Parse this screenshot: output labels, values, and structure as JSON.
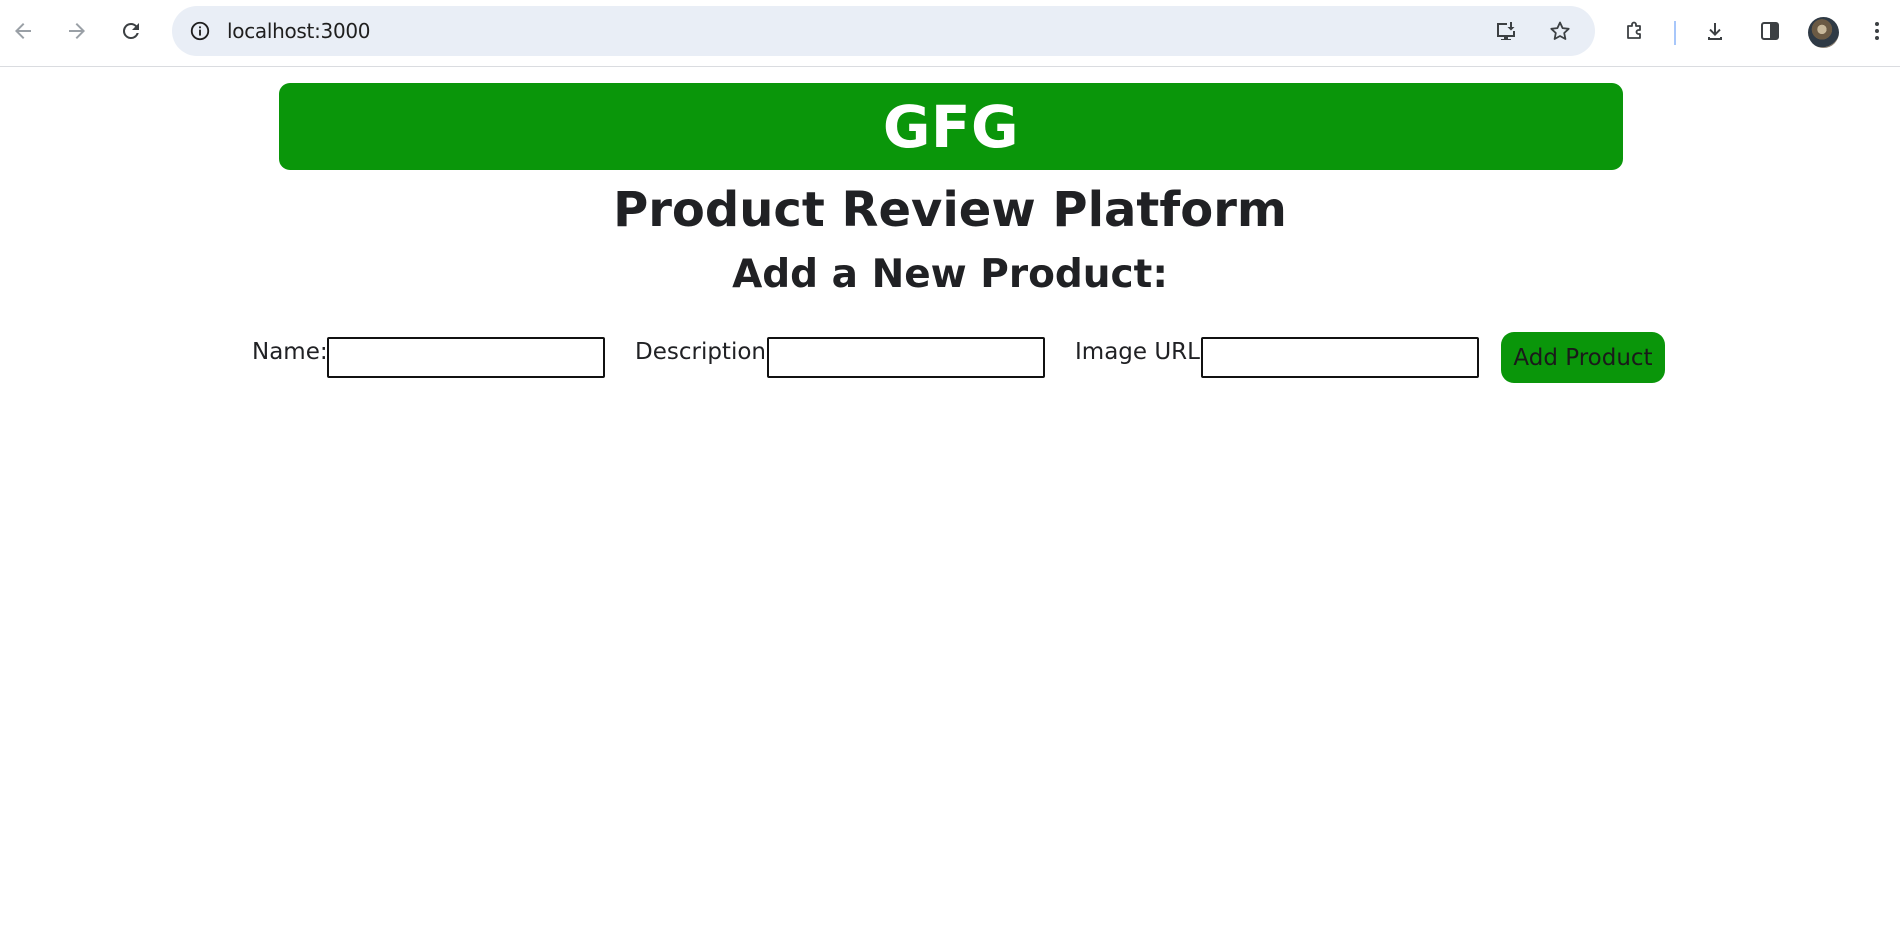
{
  "browser": {
    "url": "localhost:3000",
    "icons": {
      "back": "arrow-left-icon",
      "forward": "arrow-right-icon",
      "reload": "reload-icon",
      "site_info": "info-icon",
      "install": "install-app-icon",
      "bookmark": "star-icon",
      "extensions": "puzzle-icon",
      "downloads": "download-icon",
      "side_panel": "side-panel-icon",
      "profile": "avatar",
      "menu": "kebab-menu-icon"
    }
  },
  "page": {
    "brand": "GFG",
    "title": "Product Review Platform",
    "subtitle": "Add a New Product:",
    "form": {
      "name_label": "Name:",
      "name_value": "",
      "description_label": "Description:",
      "description_value": "",
      "image_url_label": "Image URL:",
      "image_url_value": "",
      "submit_label": "Add Product"
    }
  },
  "colors": {
    "brand_green": "#0a960a",
    "text": "#202124",
    "omnibox_bg": "#e9eef6"
  }
}
